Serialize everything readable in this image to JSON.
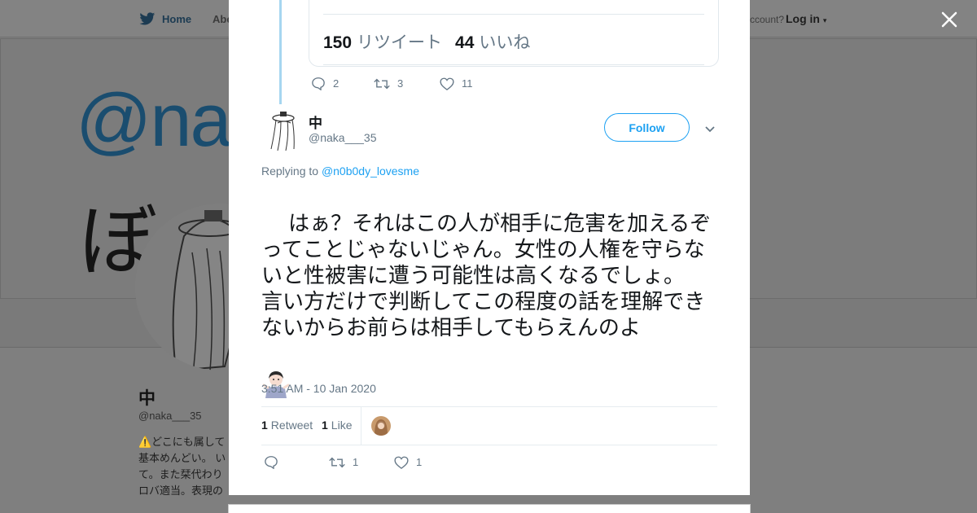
{
  "background": {
    "nav": {
      "home_label": "Home",
      "about_label": "Abo",
      "account_text": "ccount?",
      "login_label": "Log in"
    },
    "banner": {
      "handle_text": "@na",
      "second_text": "ぼ"
    },
    "profile": {
      "name": "中",
      "handle": "@naka___35",
      "bio": "⚠️どこにも属して\n基本めんどい。 い\nて。また栞代わり\nロバ適当。表現の"
    }
  },
  "modal": {
    "quoted_card": {
      "retweet_count": "150",
      "retweet_label": "リツイート",
      "like_count": "44",
      "like_label": "いいね"
    },
    "parent_actions": {
      "replies": "2",
      "retweets": "3",
      "likes": "11"
    },
    "tweet": {
      "author_name": "中",
      "author_handle": "@naka___35",
      "follow_label": "Follow",
      "replying_to_label": "Replying to",
      "replying_to_handle": "@n0b0dy_lovesme",
      "text": "はぁ？それはこの人が相手に危害を加えるぞってことじゃないじゃん。女性の人権を守らないと性被害に遭う可能性は高くなるでしょ。\n言い方だけで判断してこの程度の話を理解できないからお前らは相手してもらえんのよ",
      "emoji": "person-shrugging-emoji",
      "timestamp": "3:51 AM - 10 Jan 2020",
      "retweet_count": "1",
      "retweet_label": "Retweet",
      "like_count": "1",
      "like_label": "Like",
      "actions": {
        "replies": "",
        "retweets": "1",
        "likes": "1"
      }
    }
  },
  "colors": {
    "accent": "#1da1f2",
    "thread_line": "#a6d6f0",
    "muted_text": "#657786",
    "overlay": "#7f7f7f"
  }
}
